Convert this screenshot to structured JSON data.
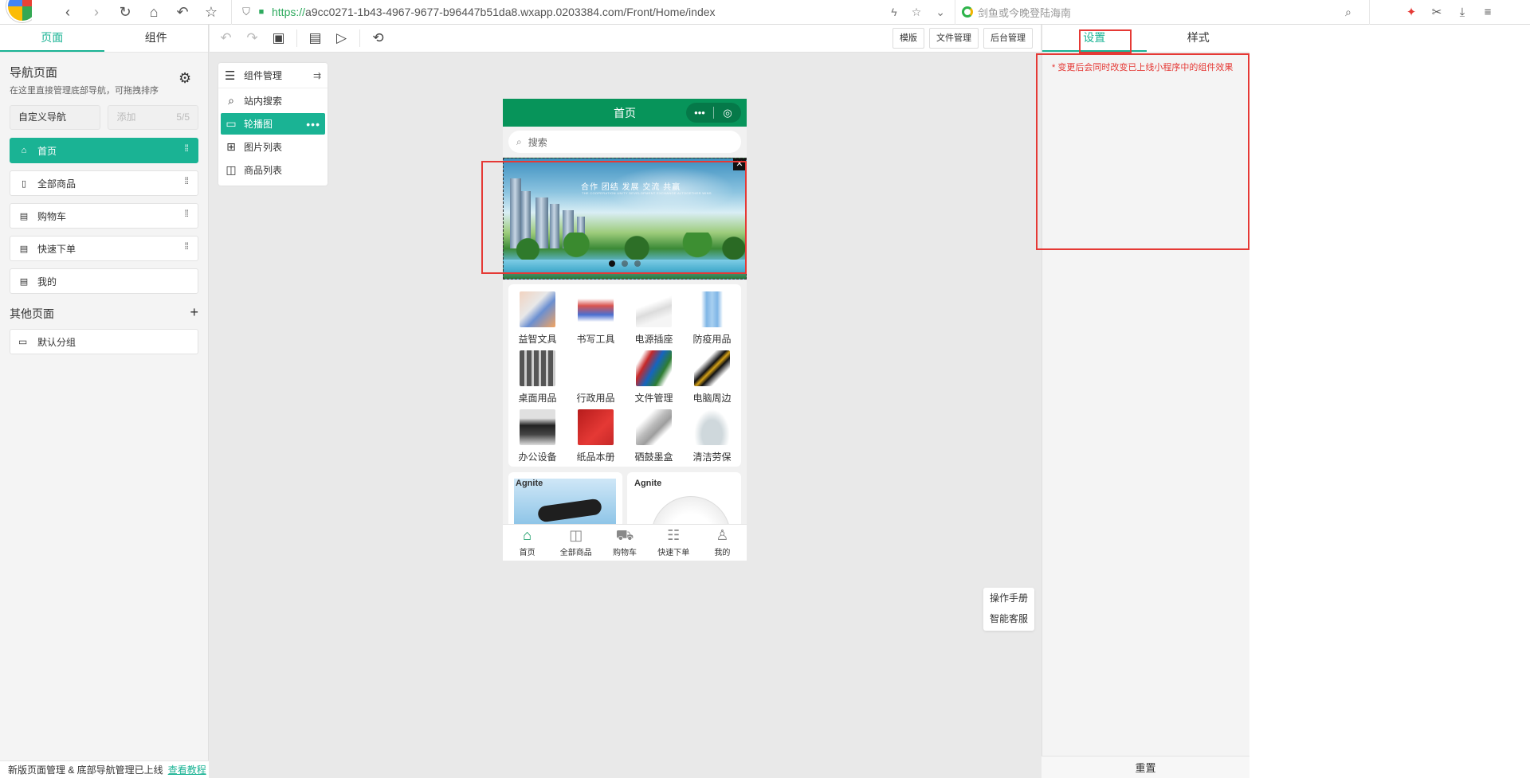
{
  "browser": {
    "url_scheme": "https://",
    "url_rest": "a9cc0271-1b43-4967-9677-b96447b51da8.wxapp.0203384.com/Front/Home/index",
    "search_placeholder": "剑鱼或今晚登陆海南"
  },
  "left": {
    "tabs": [
      "页面",
      "组件"
    ],
    "nav_title": "导航页面",
    "nav_sub": "在这里直接管理底部导航，可拖拽排序",
    "custom_nav": "自定义导航",
    "add_label": "添加",
    "add_count": "5/5",
    "nav_items": [
      "首页",
      "全部商品",
      "购物车",
      "快速下单",
      "我的"
    ],
    "other_title": "其他页面",
    "group": "默认分组",
    "footer_text": "新版页面管理 & 底部导航管理已上线",
    "footer_link": "查看教程"
  },
  "toolbar": {
    "buttons": [
      "模版",
      "文件管理",
      "后台管理"
    ]
  },
  "components": {
    "title": "组件管理",
    "items": [
      "站内搜索",
      "轮播图",
      "图片列表",
      "商品列表"
    ]
  },
  "phone": {
    "title": "首页",
    "search_placeholder": "搜索",
    "banner_title": "合作  团结  发展  交流  共赢",
    "banner_sub": "THE COOPERATION UNITY DEVELOPMENT EXCHANGE ALTOGETHER WINS",
    "categories": [
      "益智文具",
      "书写工具",
      "电源插座",
      "防疫用品",
      "桌面用品",
      "行政用品",
      "文件管理",
      "电脑周边",
      "办公设备",
      "纸品本册",
      "硒鼓墨盒",
      "清洁劳保"
    ],
    "promo_brand_1": "Agnite",
    "promo_brand_2": "Agnite",
    "tabbar": [
      "首页",
      "全部商品",
      "购物车",
      "快速下单",
      "我的"
    ]
  },
  "right": {
    "tabs": [
      "设置",
      "样式"
    ],
    "notice": "* 变更后会同时改变已上线小程序中的组件效果",
    "reset": "重置"
  },
  "help": [
    "操作手册",
    "智能客服"
  ],
  "colors": {
    "accent": "#1ab394",
    "phone_header": "#07945a",
    "highlight": "#e53935"
  }
}
